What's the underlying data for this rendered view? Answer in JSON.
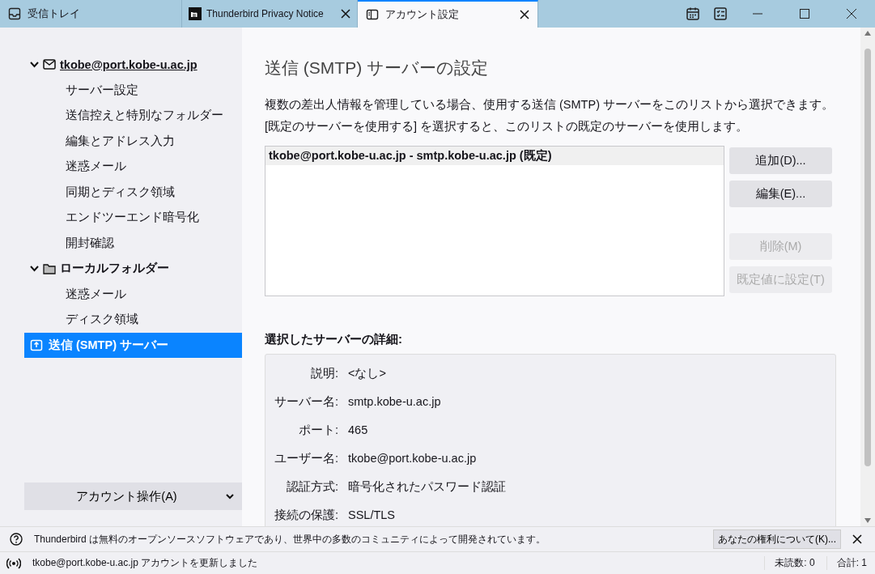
{
  "tabs": [
    {
      "kind": "inbox",
      "label": "受信トレイ",
      "selected": false
    },
    {
      "kind": "web",
      "label": "Thunderbird Privacy Notice",
      "selected": false
    },
    {
      "kind": "settings",
      "label": "アカウント設定",
      "selected": true
    }
  ],
  "sidebar": {
    "tree": [
      {
        "kind": "account",
        "label": "tkobe@port.kobe-u.ac.jp",
        "expanded": true,
        "selected": false,
        "children": [
          {
            "label": "サーバー設定",
            "selected": false
          },
          {
            "label": "送信控えと特別なフォルダー",
            "selected": false
          },
          {
            "label": "編集とアドレス入力",
            "selected": false
          },
          {
            "label": "迷惑メール",
            "selected": false
          },
          {
            "label": "同期とディスク領域",
            "selected": false
          },
          {
            "label": "エンドツーエンド暗号化",
            "selected": false
          },
          {
            "label": "開封確認",
            "selected": false
          }
        ]
      },
      {
        "kind": "folder",
        "label": "ローカルフォルダー",
        "expanded": true,
        "selected": false,
        "children": [
          {
            "label": "迷惑メール",
            "selected": false
          },
          {
            "label": "ディスク領域",
            "selected": false
          }
        ]
      },
      {
        "kind": "smtp",
        "label": "送信 (SMTP) サーバー",
        "selected": true
      }
    ],
    "account_actions": "アカウント操作(A)"
  },
  "main": {
    "title": "送信 (SMTP) サーバーの設定",
    "description": "複数の差出人情報を管理している場合、使用する送信 (SMTP) サーバーをこのリストから選択できます。[既定のサーバーを使用する] を選択すると、このリストの既定のサーバーを使用します。",
    "servers": [
      {
        "label": "tkobe@port.kobe-u.ac.jp - smtp.kobe-u.ac.jp (既定)",
        "selected": true
      }
    ],
    "buttons": [
      {
        "label": "追加(D)...",
        "disabled": false
      },
      {
        "label": "編集(E)...",
        "disabled": false
      },
      {
        "label": "削除(M)",
        "disabled": true
      },
      {
        "label": "既定値に設定(T)",
        "disabled": true
      }
    ],
    "details_title": "選択したサーバーの詳細:",
    "details": [
      {
        "label": "説明:",
        "value": "<なし>"
      },
      {
        "label": "サーバー名:",
        "value": "smtp.kobe-u.ac.jp"
      },
      {
        "label": "ポート:",
        "value": "465"
      },
      {
        "label": "ユーザー名:",
        "value": "tkobe@port.kobe-u.ac.jp"
      },
      {
        "label": "認証方式:",
        "value": "暗号化されたパスワード認証"
      },
      {
        "label": "接続の保護:",
        "value": "SSL/TLS"
      }
    ]
  },
  "notification": {
    "text": "Thunderbird は無料のオープンソースソフトウェアであり、世界中の多数のコミュニティによって開発されています。",
    "button": "あなたの権利について(K)..."
  },
  "status_bar": {
    "message": "tkobe@port.kobe-u.ac.jp アカウントを更新しました",
    "unread": "未読数: 0",
    "total": "合計: 1"
  }
}
